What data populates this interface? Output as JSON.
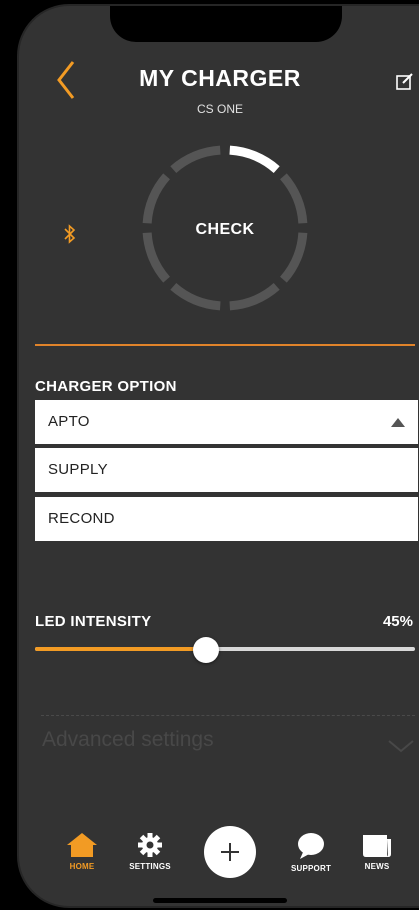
{
  "header": {
    "title": "MY CHARGER",
    "subtitle": "CS ONE",
    "back_icon": "chevron-left-icon",
    "edit_icon": "edit-icon"
  },
  "device": {
    "action_label": "CHECK",
    "bluetooth_icon": "bluetooth-icon",
    "ring_segments": 8,
    "ring_progress": 0.125
  },
  "charger_option": {
    "title": "CHARGER OPTION",
    "selected": "APTO",
    "options": [
      "APTO",
      "SUPPLY",
      "RECOND"
    ]
  },
  "led": {
    "label": "LED INTENSITY",
    "value_text": "45%",
    "value": 0.45
  },
  "advanced": {
    "label": "Advanced settings"
  },
  "nav": {
    "home": "HOME",
    "settings": "SETTINGS",
    "support": "SUPPORT",
    "news": "NEWS"
  },
  "colors": {
    "accent": "#f29b24",
    "background": "#333333",
    "divider": "#e0832a"
  }
}
